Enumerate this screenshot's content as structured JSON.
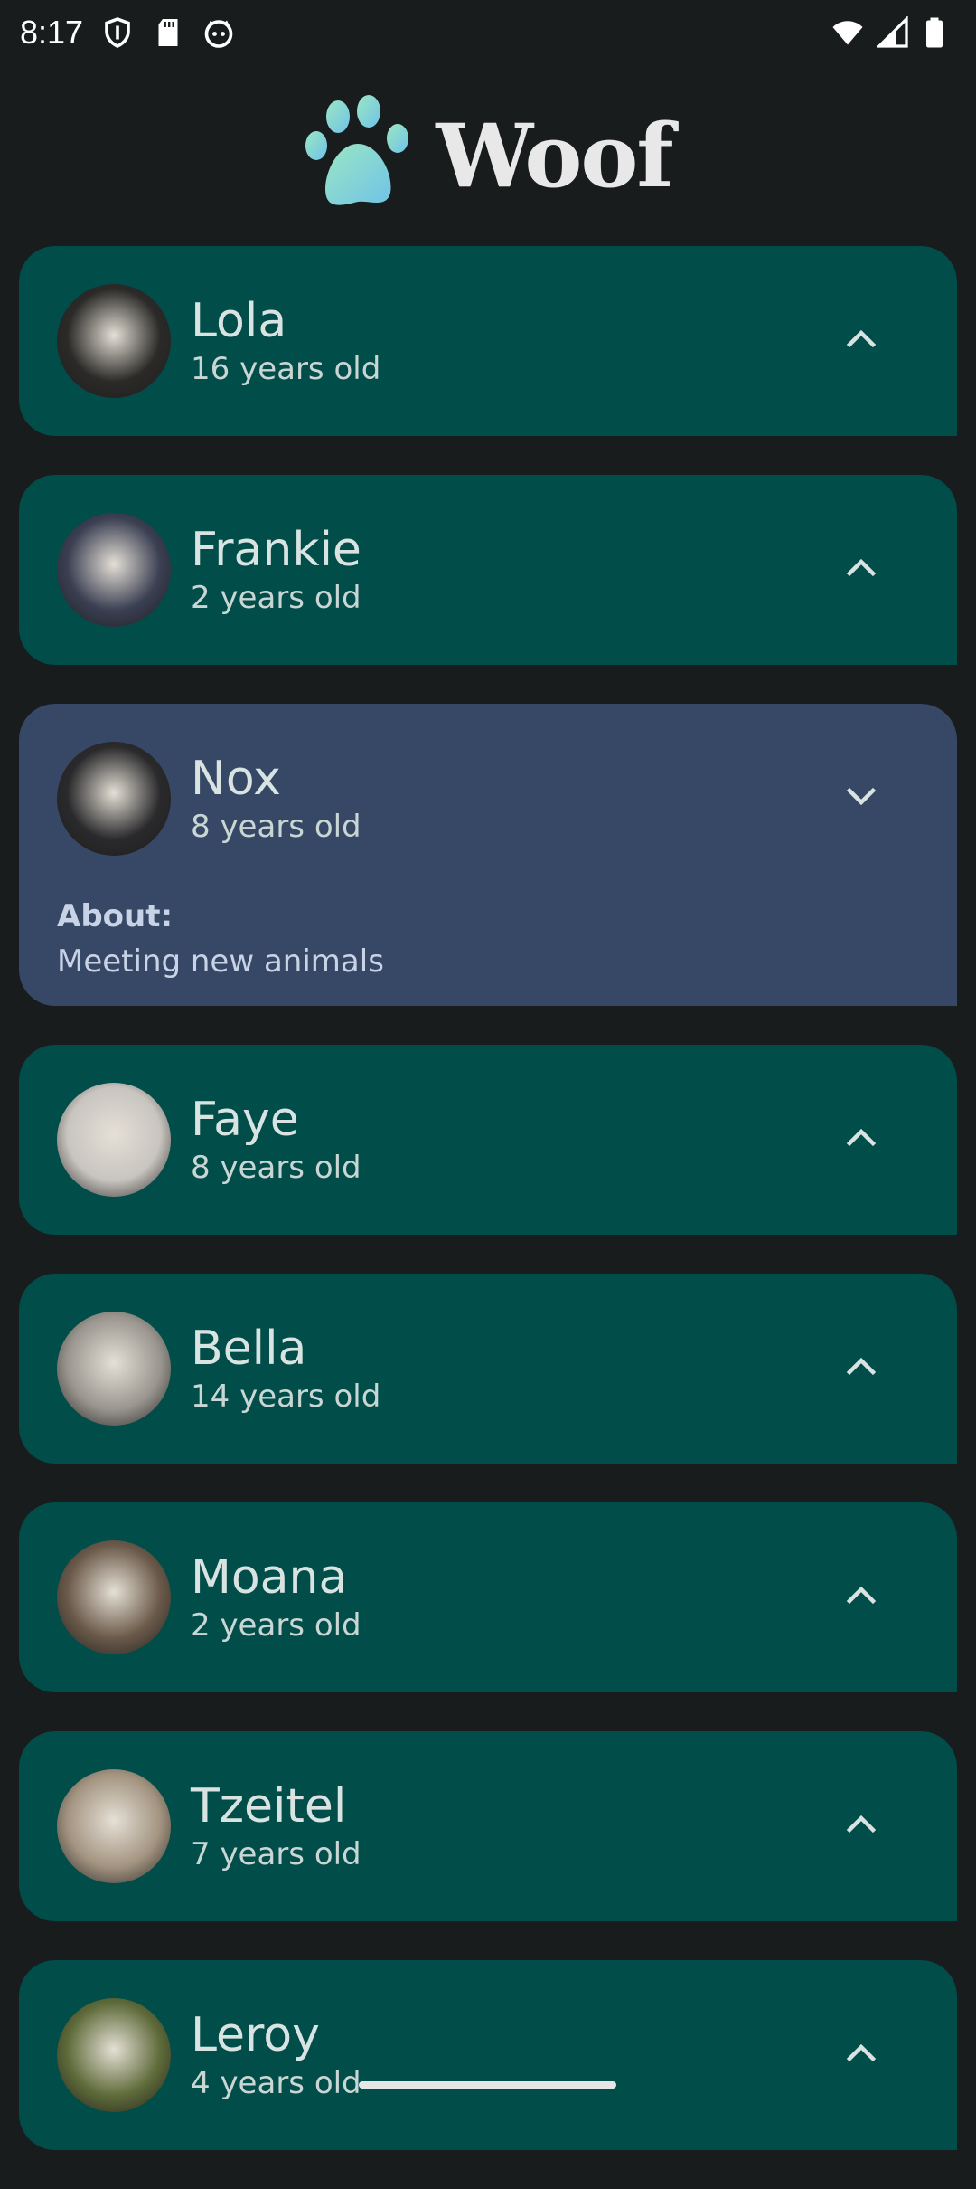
{
  "status_bar": {
    "time": "8:17",
    "left_icons": [
      "shield-icon",
      "sd-card-icon",
      "cat-face-icon"
    ],
    "right_icons": [
      "wifi-icon",
      "cellular-signal-icon",
      "battery-icon"
    ]
  },
  "app": {
    "title": "Woof",
    "logo_icon": "paw-icon"
  },
  "dogs": [
    {
      "name": "Lola",
      "age": "16 years old",
      "expanded": false,
      "avatar_color": "#2b2a28"
    },
    {
      "name": "Frankie",
      "age": "2 years old",
      "expanded": false,
      "avatar_color": "#3a3f52"
    },
    {
      "name": "Nox",
      "age": "8 years old",
      "expanded": true,
      "avatar_color": "#2a2a2c",
      "about_label": "About:",
      "about_text": "Meeting new animals"
    },
    {
      "name": "Faye",
      "age": "8 years old",
      "expanded": false,
      "avatar_color": "#c8c4bf"
    },
    {
      "name": "Bella",
      "age": "14 years old",
      "expanded": false,
      "avatar_color": "#9a968f"
    },
    {
      "name": "Moana",
      "age": "2 years old",
      "expanded": false,
      "avatar_color": "#6b5a4a"
    },
    {
      "name": "Tzeitel",
      "age": "7 years old",
      "expanded": false,
      "avatar_color": "#a39480"
    },
    {
      "name": "Leroy",
      "age": "4 years old",
      "expanded": false,
      "avatar_color": "#5f6b3a"
    }
  ],
  "colors": {
    "background": "#191c1d",
    "card": "#004d4a",
    "card_expanded": "#364866"
  }
}
